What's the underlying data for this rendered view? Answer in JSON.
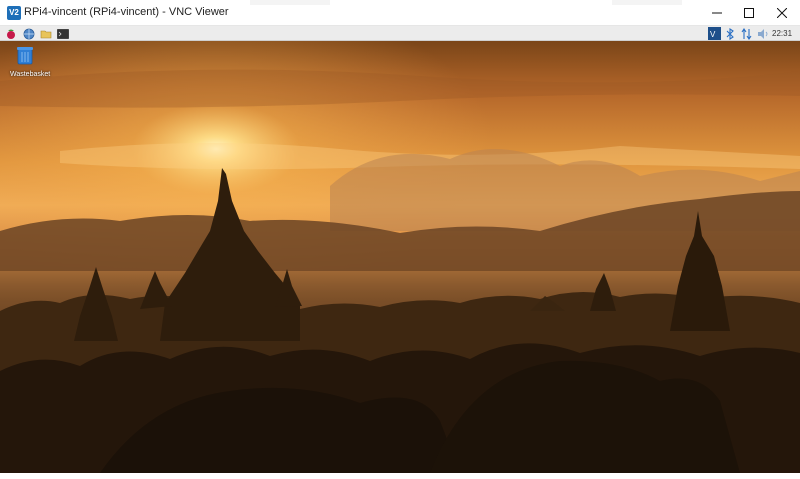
{
  "window": {
    "app_icon": "vnc-viewer-icon",
    "app_icon_text": "V2",
    "title": "RPi4-vincent (RPi4-vincent) - VNC Viewer",
    "controls": [
      "minimize-icon",
      "maximize-icon",
      "close-icon"
    ]
  },
  "panel": {
    "launchers": [
      "raspberry-menu-icon",
      "web-browser-icon",
      "file-manager-icon",
      "terminal-icon"
    ],
    "tray": [
      "vnc-tray-icon",
      "bluetooth-icon",
      "network-icon",
      "volume-icon"
    ],
    "clock": "22:31"
  },
  "desktop": {
    "wallpaper": "sunset-temples-landscape",
    "icons": [
      {
        "name": "trash-icon",
        "label": "Wastebasket"
      }
    ]
  },
  "colors": {
    "titlebar": "#ffffff",
    "panel": "#ececec",
    "vnc_blue": "#1e6fb8",
    "sky_top": "#c9782e",
    "sun": "#ffe9a0"
  }
}
